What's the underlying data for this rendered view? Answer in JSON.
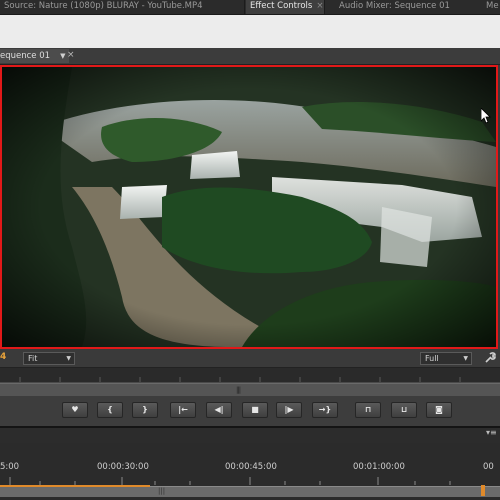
{
  "top_tabs": [
    {
      "label": "Source: Nature (1080p) BLURAY - YouTube.MP4",
      "active": false
    },
    {
      "label": "Effect Controls",
      "active": true
    },
    {
      "label": "Audio Mixer: Sequence 01",
      "active": false
    },
    {
      "label": "Me",
      "active": false
    }
  ],
  "program_monitor": {
    "sequence_tab": "equence 01",
    "timecode_fragment": "4",
    "zoom_select": "Fit",
    "quality_select": "Full"
  },
  "transport": {
    "buttons": [
      {
        "name": "add-marker-button",
        "glyph": "♥"
      },
      {
        "name": "mark-in-button",
        "glyph": "{"
      },
      {
        "name": "mark-out-button",
        "glyph": "}"
      },
      {
        "name": "go-to-in-button",
        "glyph": "|←"
      },
      {
        "name": "step-back-button",
        "glyph": "◀|"
      },
      {
        "name": "stop-button",
        "glyph": "■"
      },
      {
        "name": "step-forward-button",
        "glyph": "|▶"
      },
      {
        "name": "go-to-out-button",
        "glyph": "→}"
      },
      {
        "name": "lift-button",
        "glyph": "⊓"
      },
      {
        "name": "extract-button",
        "glyph": "⊔"
      },
      {
        "name": "export-frame-button",
        "glyph": "◙"
      }
    ]
  },
  "timeline": {
    "labels": [
      "5:00",
      "00:00:30:00",
      "00:00:45:00",
      "00:01:00:00",
      "00"
    ]
  },
  "colors": {
    "selection_border": "#e11919",
    "timecode": "#e8a23a"
  }
}
